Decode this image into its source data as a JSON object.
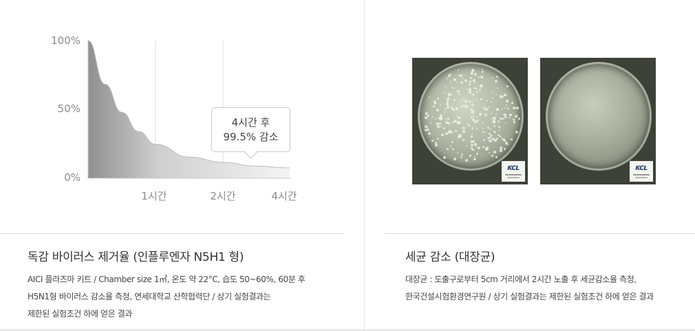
{
  "left_panel": {
    "chart": {
      "y_ticks": [
        "100%",
        "50%",
        "0%"
      ],
      "x_ticks": [
        "1시간",
        "2시간",
        "4시간"
      ],
      "callout_line1": "4시간 후",
      "callout_line2": "99.5% 감소"
    },
    "title": "독감 바이러스 제거율 (인플루엔자 N5H1 형)",
    "desc_lines": [
      "AICI 플라즈마 키트 / Chamber size 1㎥, 온도 약 22°C, 습도 50~60%, 60분 후",
      "H5N1형 바이러스 감소율 측정, 연세대학교 산학협력단 / 상기 실험결과는",
      "제한된 실험조건 하에 얻은 결과"
    ]
  },
  "right_panel": {
    "title": "세균 감소 (대장균)",
    "desc_lines": [
      "대장균 : 도출구로부터 5cm 거리에서 2시간 노출 후 세균감소율 측정,",
      "한국건설시험환경연구원 / 상기 실험결과는 제한된 실험조건 하에 얻은 결과"
    ],
    "photos": [
      {
        "name": "petri-dish-before",
        "logo": "KCL"
      },
      {
        "name": "petri-dish-after",
        "logo": "KCL"
      }
    ]
  },
  "chart_data": {
    "type": "area",
    "x_labels": [
      "1시간",
      "2시간",
      "4시간"
    ],
    "y_tick_labels": [
      "100%",
      "50%",
      "0%"
    ],
    "ylim": [
      0,
      100
    ],
    "annotation": "4시간 후 99.5% 감소",
    "points": [
      {
        "t": 0,
        "y": 100
      },
      {
        "t": 0.25,
        "y": 66
      },
      {
        "t": 0.5,
        "y": 44
      },
      {
        "t": 0.75,
        "y": 29
      },
      {
        "t": 1,
        "y": 19
      },
      {
        "t": 1.5,
        "y": 9
      },
      {
        "t": 2,
        "y": 5
      },
      {
        "t": 3,
        "y": 2
      },
      {
        "t": 4,
        "y": 0.5
      }
    ],
    "colors": {
      "fill_top": "#9c9c9c",
      "fill_bottom": "#f5f5f5",
      "grid": "#dcdcdc"
    }
  }
}
